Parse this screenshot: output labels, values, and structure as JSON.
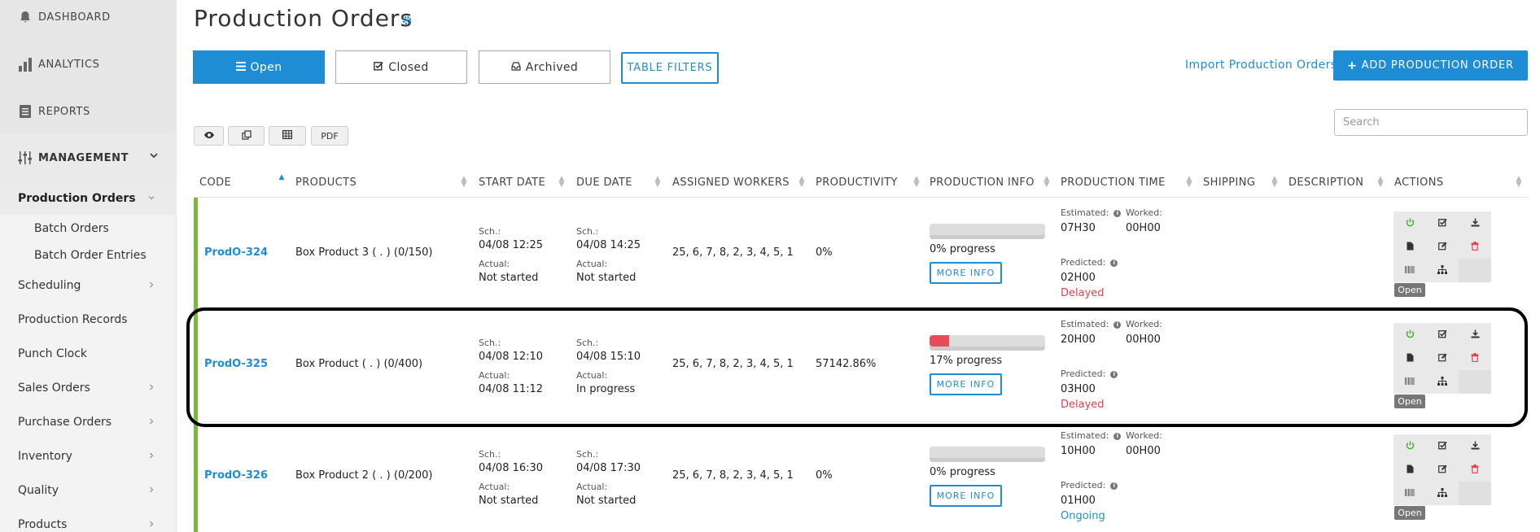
{
  "sidebar": {
    "dashboard": "DASHBOARD",
    "analytics": "ANALYTICS",
    "reports": "REPORTS",
    "management": "MANAGEMENT",
    "production_orders": "Production Orders",
    "batch_orders": "Batch Orders",
    "batch_order_entries": "Batch Order Entries",
    "scheduling": "Scheduling",
    "production_records": "Production Records",
    "punch_clock": "Punch Clock",
    "sales_orders": "Sales Orders",
    "purchase_orders": "Purchase Orders",
    "inventory": "Inventory",
    "quality": "Quality",
    "products": "Products"
  },
  "header": {
    "title": "Production Orders",
    "tabs": {
      "open": "Open",
      "closed": "Closed",
      "archived": "Archived"
    },
    "table_filters": "TABLE FILTERS",
    "import": "Import Production Orders",
    "add": "ADD PRODUCTION ORDER",
    "search_placeholder": "Search"
  },
  "toolbar": {
    "pdf": "PDF"
  },
  "columns": {
    "code": "CODE",
    "products": "PRODUCTS",
    "start_date": "START DATE",
    "due_date": "DUE DATE",
    "assigned_workers": "ASSIGNED WORKERS",
    "productivity": "PRODUCTIVITY",
    "production_info": "PRODUCTION INFO",
    "production_time": "PRODUCTION TIME",
    "shipping": "SHIPPING",
    "description": "DESCRIPTION",
    "actions": "ACTIONS"
  },
  "labels": {
    "sch": "Sch.:",
    "actual": "Actual:",
    "estimated": "Estimated:",
    "worked": "Worked:",
    "predicted": "Predicted:",
    "more_info": "MORE INFO"
  },
  "rows": [
    {
      "code": "ProdO-324",
      "product": "Box Product 3 ( . ) (0/150)",
      "start_sch": "04/08   12:25",
      "start_actual": "Not started",
      "due_sch": "04/08   14:25",
      "due_actual": "Not started",
      "workers": "25, 6, 7, 8, 2, 3, 4, 5, 1",
      "productivity": "0%",
      "progress": 0,
      "progress_text": "0% progress",
      "estimated": "07H30",
      "worked": "00H00",
      "predicted": "02H00",
      "status_text": "Delayed",
      "badge": "Open"
    },
    {
      "code": "ProdO-325",
      "product": "Box Product ( . ) (0/400)",
      "start_sch": "04/08   12:10",
      "start_actual": "04/08   11:12",
      "due_sch": "04/08   15:10",
      "due_actual": "In progress",
      "workers": "25, 6, 7, 8, 2, 3, 4, 5, 1",
      "productivity": "57142.86%",
      "progress": 17,
      "progress_text": "17% progress",
      "estimated": "20H00",
      "worked": "00H00",
      "predicted": "03H00",
      "status_text": "Delayed",
      "badge": "Open"
    },
    {
      "code": "ProdO-326",
      "product": "Box Product 2 ( . ) (0/200)",
      "start_sch": "04/08   16:30",
      "start_actual": "Not started",
      "due_sch": "04/08   17:30",
      "due_actual": "Not started",
      "workers": "25, 6, 7, 8, 2, 3, 4, 5, 1",
      "productivity": "0%",
      "progress": 0,
      "progress_text": "0% progress",
      "estimated": "10H00",
      "worked": "00H00",
      "predicted": "01H00",
      "status_text": "Ongoing",
      "badge": "Open"
    }
  ],
  "colors": {
    "accent": "#1f8dd6",
    "delayed": "#e0414f",
    "row_bar": "#7cb83b"
  }
}
